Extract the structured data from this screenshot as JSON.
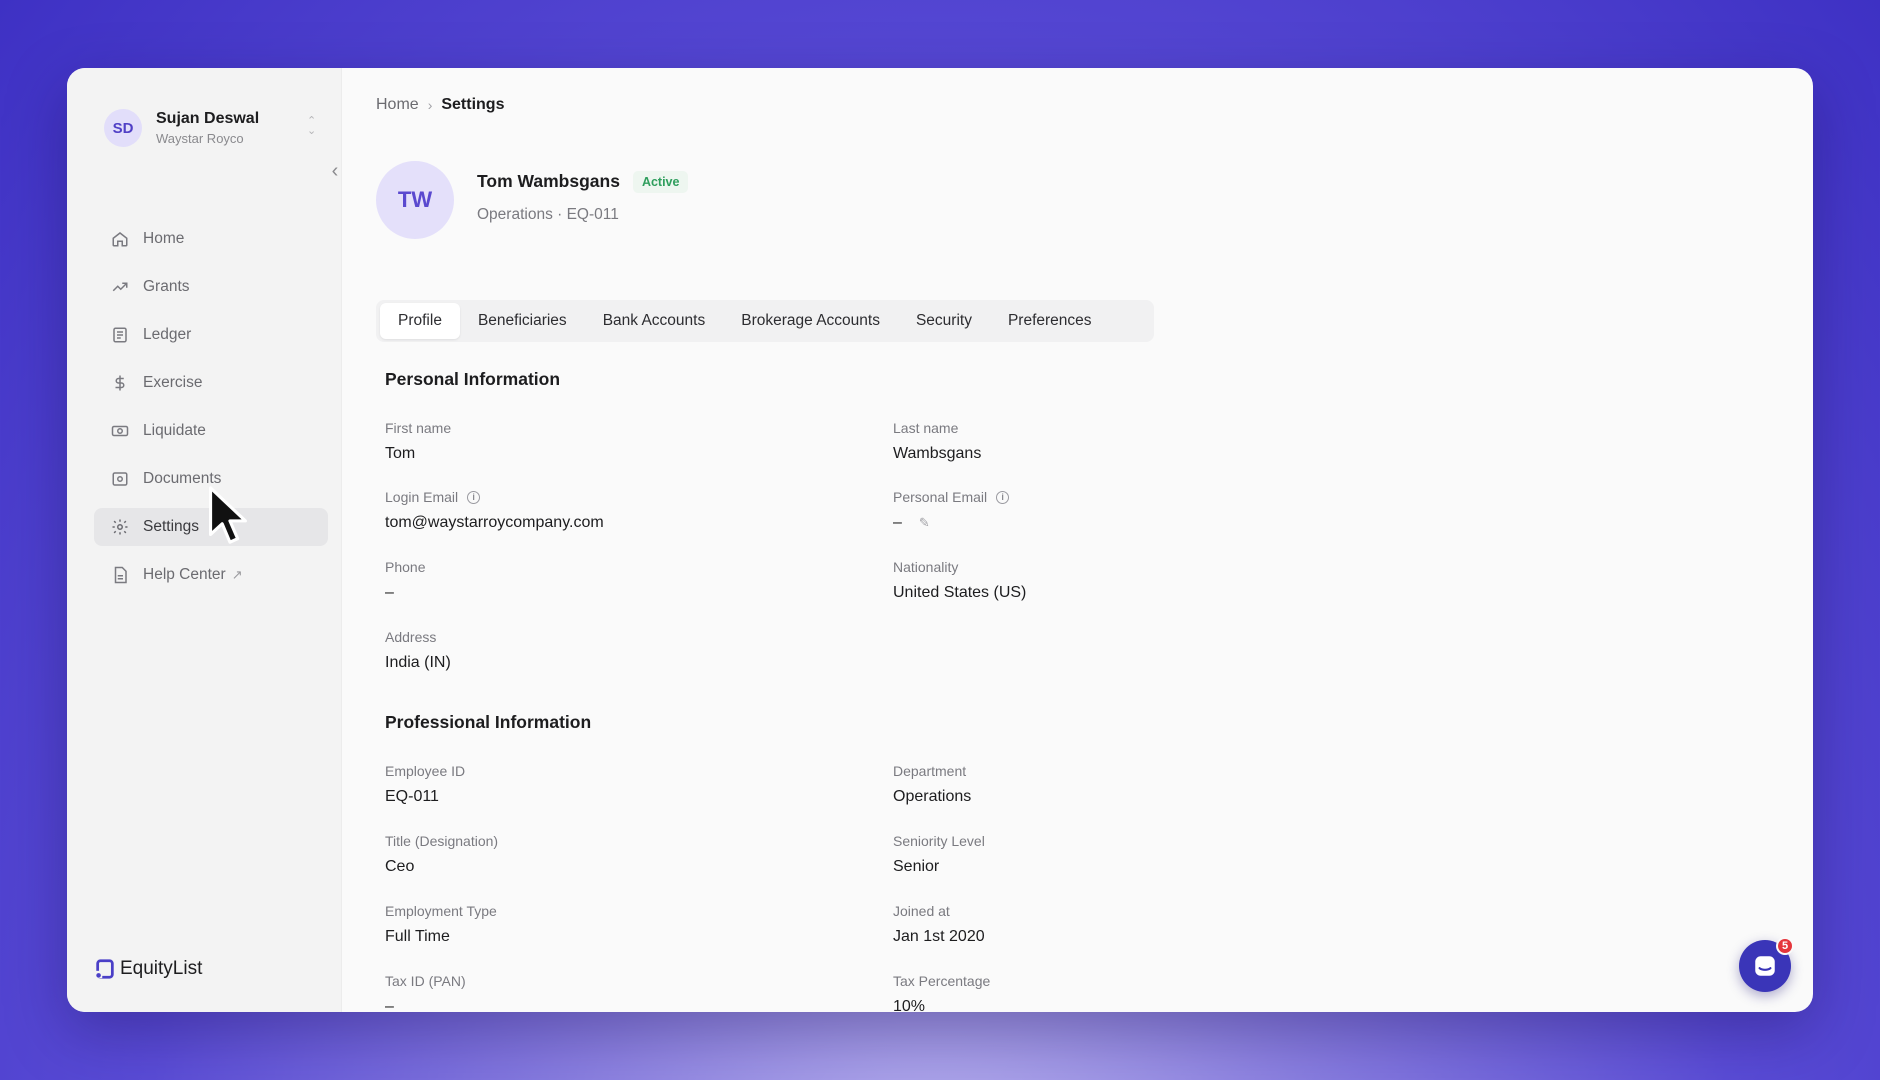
{
  "user": {
    "initials": "SD",
    "name": "Sujan Deswal",
    "org": "Waystar Royco"
  },
  "nav": [
    {
      "label": "Home",
      "icon": "home-icon"
    },
    {
      "label": "Grants",
      "icon": "trend-icon"
    },
    {
      "label": "Ledger",
      "icon": "ledger-icon"
    },
    {
      "label": "Exercise",
      "icon": "dollar-icon"
    },
    {
      "label": "Liquidate",
      "icon": "cash-icon"
    },
    {
      "label": "Documents",
      "icon": "documents-icon"
    },
    {
      "label": "Settings",
      "icon": "gear-icon",
      "active": true
    },
    {
      "label": "Help Center",
      "icon": "help-doc-icon"
    }
  ],
  "brand": {
    "name": "EquityList"
  },
  "breadcrumb": {
    "home": "Home",
    "current": "Settings"
  },
  "profile": {
    "initials": "TW",
    "name": "Tom Wambsgans",
    "status": "Active",
    "subtitle": "Operations · EQ-011"
  },
  "tabs": [
    "Profile",
    "Beneficiaries",
    "Bank Accounts",
    "Brokerage Accounts",
    "Security",
    "Preferences"
  ],
  "personal": {
    "title": "Personal Information",
    "first_name_label": "First name",
    "first_name": "Tom",
    "last_name_label": "Last name",
    "last_name": "Wambsgans",
    "login_email_label": "Login Email",
    "login_email": "tom@waystarroycompany.com",
    "personal_email_label": "Personal Email",
    "personal_email": "–",
    "phone_label": "Phone",
    "phone": "–",
    "nationality_label": "Nationality",
    "nationality": "United States (US)",
    "address_label": "Address",
    "address": "India (IN)"
  },
  "professional": {
    "title": "Professional Information",
    "employee_id_label": "Employee ID",
    "employee_id": "EQ-011",
    "department_label": "Department",
    "department": "Operations",
    "designation_label": "Title (Designation)",
    "designation": "Ceo",
    "seniority_label": "Seniority Level",
    "seniority": "Senior",
    "employment_type_label": "Employment Type",
    "employment_type": "Full Time",
    "joined_label": "Joined at",
    "joined": "Jan 1st 2020",
    "tax_id_label": "Tax ID (PAN)",
    "tax_id": "–",
    "tax_pct_label": "Tax Percentage",
    "tax_pct": "10%"
  },
  "chat": {
    "badge_count": "5"
  },
  "colors": {
    "accent": "#5040c6",
    "active_badge": "#2f9e5d",
    "chat": "#3a35b8"
  }
}
